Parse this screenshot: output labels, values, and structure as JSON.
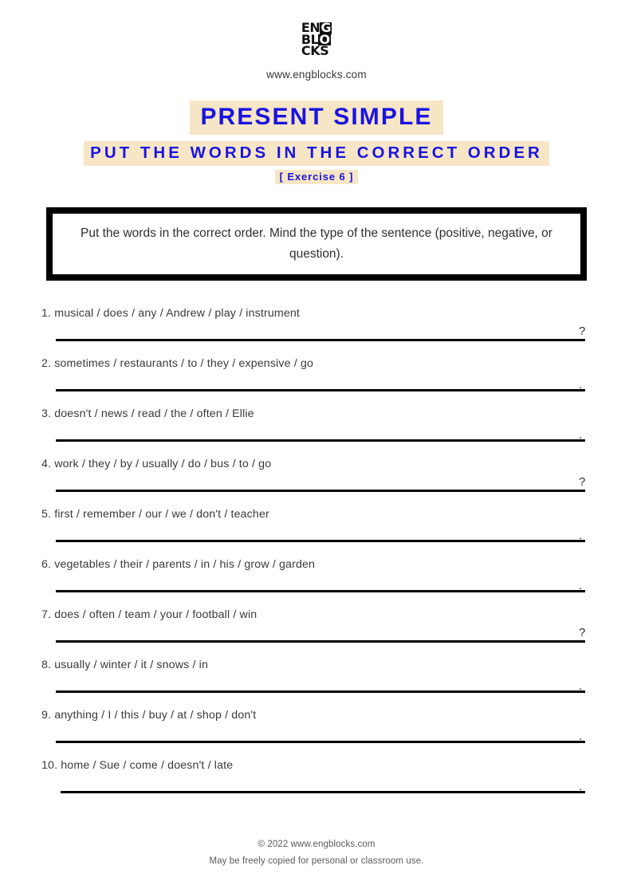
{
  "brand": {
    "logo_line1_a": "EN",
    "logo_line1_b": "G",
    "logo_line2_a": "BL",
    "logo_line2_b": "O",
    "logo_line3": "CKS",
    "site_url": "www.engblocks.com"
  },
  "header": {
    "title": "PRESENT SIMPLE",
    "subtitle": "PUT THE WORDS IN THE CORRECT ORDER",
    "exercise_label": "[ Exercise 6 ]"
  },
  "instruction": {
    "text": "Put the words in the correct order. Mind the type of the sentence (positive, negative, or question)."
  },
  "exercises": [
    {
      "number": "1.",
      "prompt": "1. musical / does / any / Andrew / play / instrument",
      "punct": "?"
    },
    {
      "number": "2.",
      "prompt": "2. sometimes / restaurants / to / they / expensive / go",
      "punct": "."
    },
    {
      "number": "3.",
      "prompt": "3. doesn't / news / read / the / often / Ellie",
      "punct": "."
    },
    {
      "number": "4.",
      "prompt": "4. work / they / by / usually / do / bus / to / go",
      "punct": "?"
    },
    {
      "number": "5.",
      "prompt": "5. first / remember / our / we / don't / teacher",
      "punct": "."
    },
    {
      "number": "6.",
      "prompt": "6. vegetables / their / parents / in / his / grow / garden",
      "punct": "."
    },
    {
      "number": "7.",
      "prompt": "7. does / often / team / your / football / win",
      "punct": "?"
    },
    {
      "number": "8.",
      "prompt": "8. usually / winter / it / snows / in",
      "punct": "."
    },
    {
      "number": "9.",
      "prompt": "9. anything / I / this / buy / at / shop / don't",
      "punct": "."
    },
    {
      "number": "10.",
      "prompt": "10. home / Sue / come / doesn't / late",
      "punct": "."
    }
  ],
  "footer": {
    "copyright": "© 2022 www.engblocks.com",
    "note": "May be freely copied for personal or classroom use."
  },
  "colors": {
    "highlight": "#f6e6c6",
    "title_blue": "#1a13e0",
    "text": "#3a3a3a",
    "rule": "#000000"
  }
}
